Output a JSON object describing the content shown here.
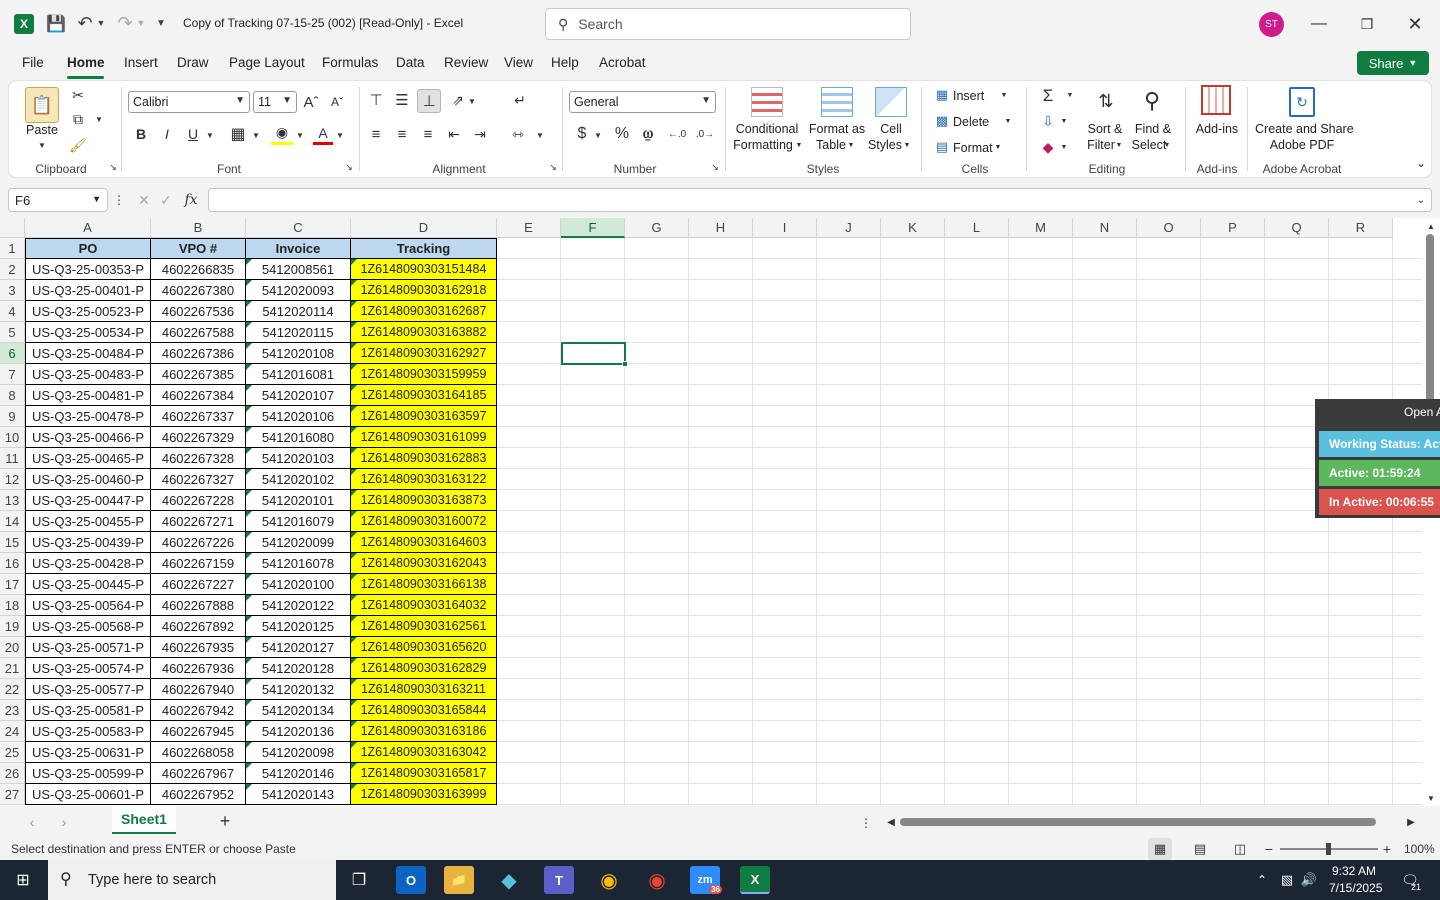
{
  "titlebar": {
    "title": "Copy of Tracking 07-15-25 (002)  [Read-Only]  -  Excel",
    "search_placeholder": "Search",
    "avatar_initials": "ST"
  },
  "menu": {
    "file": "File",
    "home": "Home",
    "insert": "Insert",
    "draw": "Draw",
    "page_layout": "Page Layout",
    "formulas": "Formulas",
    "data": "Data",
    "review": "Review",
    "view": "View",
    "help": "Help",
    "acrobat": "Acrobat",
    "share": "Share"
  },
  "ribbon": {
    "clipboard": {
      "paste": "Paste",
      "label": "Clipboard"
    },
    "font": {
      "name": "Calibri",
      "size": "11",
      "label": "Font"
    },
    "alignment": {
      "label": "Alignment"
    },
    "number": {
      "format": "General",
      "label": "Number"
    },
    "styles": {
      "conditional": "Conditional",
      "formatting": "Formatting",
      "format_as": "Format as",
      "table": "Table",
      "cell": "Cell",
      "cell_styles": "Styles",
      "label": "Styles"
    },
    "cells": {
      "insert": "Insert",
      "delete": "Delete",
      "format": "Format",
      "label": "Cells"
    },
    "editing": {
      "sort": "Sort &",
      "filter": "Filter",
      "find": "Find &",
      "select": "Select",
      "label": "Editing"
    },
    "addins": {
      "addins": "Add-ins",
      "label": "Add-ins"
    },
    "acrobat": {
      "line1": "Create and Share",
      "line2": "Adobe PDF",
      "label": "Adobe Acrobat"
    }
  },
  "formula_bar": {
    "name_box": "F6",
    "fx": "fx",
    "value": ""
  },
  "columns": [
    "A",
    "B",
    "C",
    "D",
    "E",
    "F",
    "G",
    "H",
    "I",
    "J",
    "K",
    "L",
    "M",
    "N",
    "O",
    "P",
    "Q",
    "R"
  ],
  "table": {
    "headers": [
      "PO",
      "VPO #",
      "Invoice",
      "Tracking"
    ],
    "rows": [
      [
        "US-Q3-25-00353-P",
        "4602266835",
        "5412008561",
        "1Z6148090303151484"
      ],
      [
        "US-Q3-25-00401-P",
        "4602267380",
        "5412020093",
        "1Z6148090303162918"
      ],
      [
        "US-Q3-25-00523-P",
        "4602267536",
        "5412020114",
        "1Z6148090303162687"
      ],
      [
        "US-Q3-25-00534-P",
        "4602267588",
        "5412020115",
        "1Z6148090303163882"
      ],
      [
        "US-Q3-25-00484-P",
        "4602267386",
        "5412020108",
        "1Z6148090303162927"
      ],
      [
        "US-Q3-25-00483-P",
        "4602267385",
        "5412016081",
        "1Z6148090303159959"
      ],
      [
        "US-Q3-25-00481-P",
        "4602267384",
        "5412020107",
        "1Z6148090303164185"
      ],
      [
        "US-Q3-25-00478-P",
        "4602267337",
        "5412020106",
        "1Z6148090303163597"
      ],
      [
        "US-Q3-25-00466-P",
        "4602267329",
        "5412016080",
        "1Z6148090303161099"
      ],
      [
        "US-Q3-25-00465-P",
        "4602267328",
        "5412020103",
        "1Z6148090303162883"
      ],
      [
        "US-Q3-25-00460-P",
        "4602267327",
        "5412020102",
        "1Z6148090303163122"
      ],
      [
        "US-Q3-25-00447-P",
        "4602267228",
        "5412020101",
        "1Z6148090303163873"
      ],
      [
        "US-Q3-25-00455-P",
        "4602267271",
        "5412016079",
        "1Z6148090303160072"
      ],
      [
        "US-Q3-25-00439-P",
        "4602267226",
        "5412020099",
        "1Z6148090303164603"
      ],
      [
        "US-Q3-25-00428-P",
        "4602267159",
        "5412016078",
        "1Z6148090303162043"
      ],
      [
        "US-Q3-25-00445-P",
        "4602267227",
        "5412020100",
        "1Z6148090303166138"
      ],
      [
        "US-Q3-25-00564-P",
        "4602267888",
        "5412020122",
        "1Z6148090303164032"
      ],
      [
        "US-Q3-25-00568-P",
        "4602267892",
        "5412020125",
        "1Z6148090303162561"
      ],
      [
        "US-Q3-25-00571-P",
        "4602267935",
        "5412020127",
        "1Z6148090303165620"
      ],
      [
        "US-Q3-25-00574-P",
        "4602267936",
        "5412020128",
        "1Z6148090303162829"
      ],
      [
        "US-Q3-25-00577-P",
        "4602267940",
        "5412020132",
        "1Z6148090303163211"
      ],
      [
        "US-Q3-25-00581-P",
        "4602267942",
        "5412020134",
        "1Z6148090303165844"
      ],
      [
        "US-Q3-25-00583-P",
        "4602267945",
        "5412020136",
        "1Z6148090303163186"
      ],
      [
        "US-Q3-25-00631-P",
        "4602268058",
        "5412020098",
        "1Z6148090303163042"
      ],
      [
        "US-Q3-25-00599-P",
        "4602267967",
        "5412020146",
        "1Z6148090303165817"
      ],
      [
        "US-Q3-25-00601-P",
        "4602267952",
        "5412020143",
        "1Z6148090303163999"
      ]
    ]
  },
  "selected_cell": "F6",
  "sheet": {
    "tab": "Sheet1"
  },
  "status": {
    "message": "Select destination and press ENTER or choose Paste",
    "zoom": "100%"
  },
  "overlay": {
    "open": "Open A",
    "working_status": "Working Status: Act",
    "active": "Active: 01:59:24",
    "inactive": "In Active: 00:06:55"
  },
  "taskbar": {
    "search_placeholder": "Type here to search",
    "time": "9:32 AM",
    "date": "7/15/2025",
    "notifications": "21",
    "zoom_badge": "36"
  },
  "colors": {
    "excel_green": "#107c41",
    "header_fill": "#bdd7ee",
    "tracking_fill": "#ffff00",
    "avatar": "#d01c8b"
  }
}
